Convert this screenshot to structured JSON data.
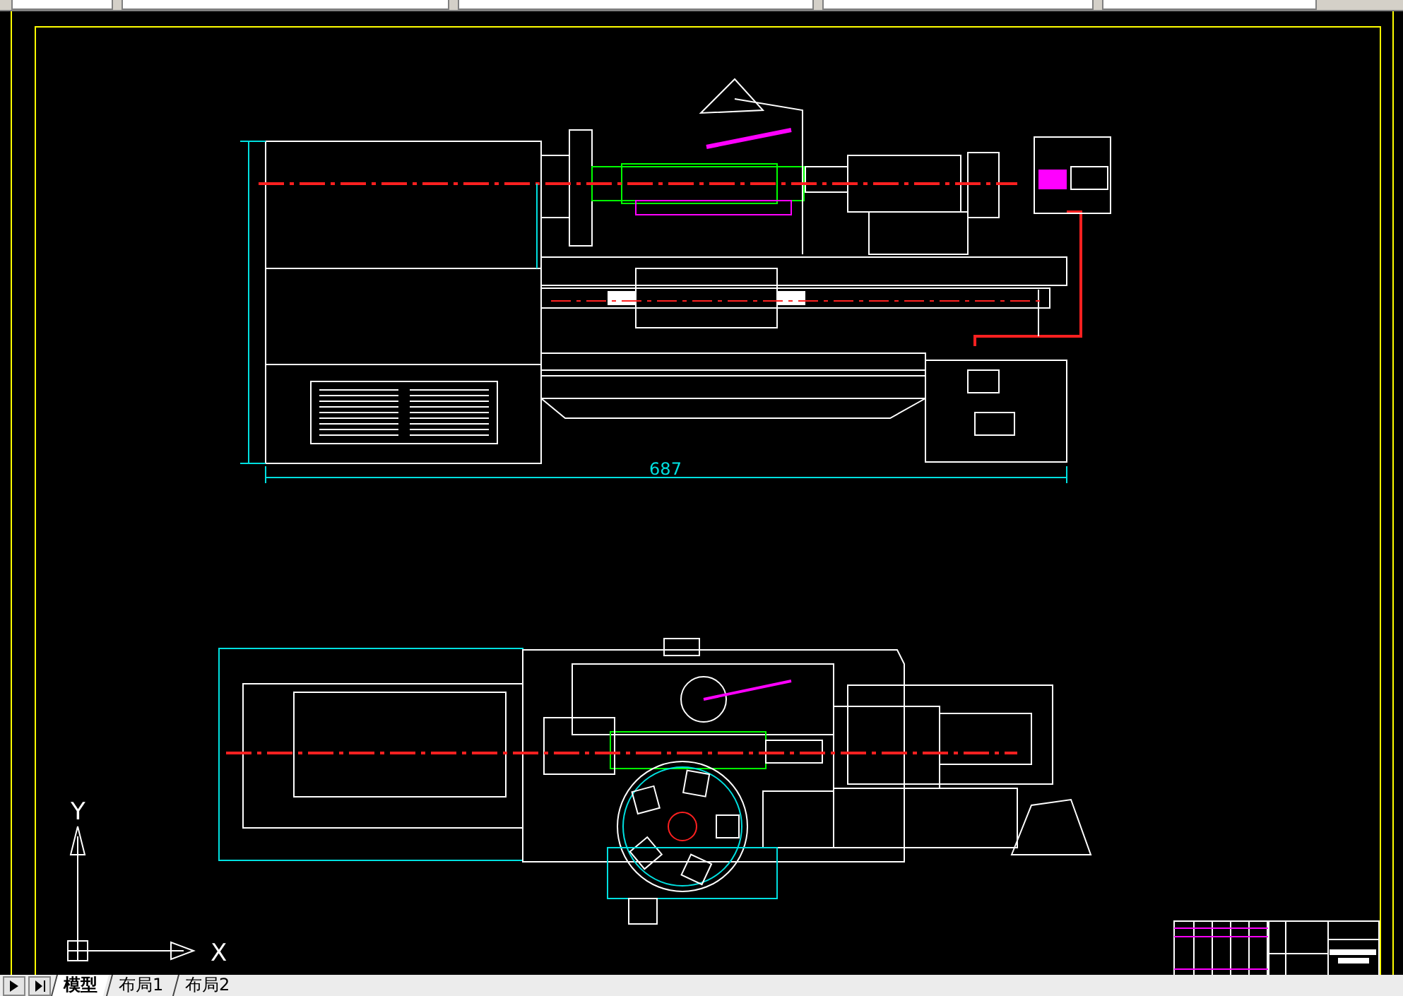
{
  "drawing": {
    "dimension": "687"
  },
  "ucs": {
    "x_label": "X",
    "y_label": "Y"
  },
  "tabs": [
    {
      "label": "模型",
      "selected": true
    },
    {
      "label": "布局1",
      "selected": false
    },
    {
      "label": "布局2",
      "selected": false
    }
  ]
}
